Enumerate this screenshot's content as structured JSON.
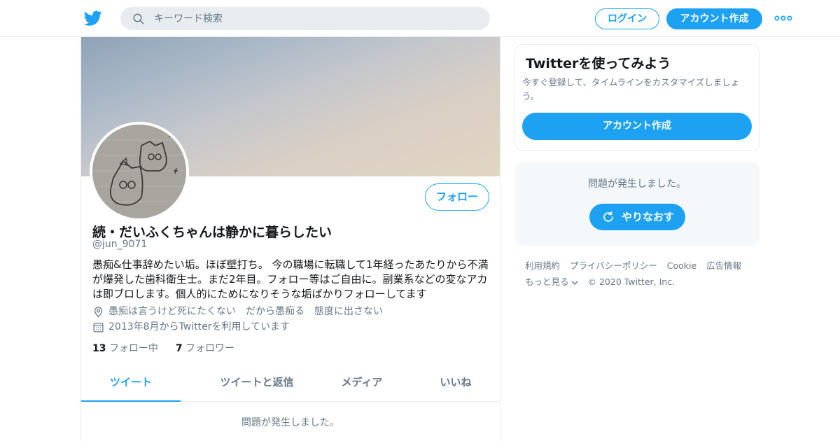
{
  "header": {
    "logo_icon": "twitter-bird-icon",
    "search_placeholder": "キーワード検索",
    "search_icon": "search-icon",
    "login_label": "ログイン",
    "signup_label": "アカウント作成",
    "more_icon": "more-dots-icon"
  },
  "profile": {
    "avatar_icon": "profile-avatar",
    "follow_label": "フォロー",
    "name": "続・だいふくちゃんは静かに暮らしたい",
    "handle": "@jun_9071",
    "bio": "愚痴&仕事辞めたい垢。ほぼ壁打ち。 今の職場に転職して1年経ったあたりから不満が爆発した歯科衛生士。まだ2年目。フォロー等はご自由に。副業系などの変なアカは即ブロします。個人的にためになりそうな垢ばかりフォローしてます",
    "location": "愚痴は言うけど死にたくない　だから愚痴る　態度に出さない",
    "location_icon": "location-pin-icon",
    "joined": "2013年8月からTwitterを利用しています",
    "joined_icon": "calendar-icon",
    "following_count": "13",
    "following_label": "フォロー中",
    "followers_count": "7",
    "followers_label": "フォロワー"
  },
  "tabs": [
    {
      "label": "ツイート",
      "active": true
    },
    {
      "label": "ツイートと返信",
      "active": false
    },
    {
      "label": "メディア",
      "active": false
    },
    {
      "label": "いいね",
      "active": false
    }
  ],
  "timeline": {
    "error_message": "問題が発生しました。"
  },
  "signup_card": {
    "title": "Twitterを使ってみよう",
    "description": "今すぐ登録して、タイムラインをカスタマイズしましょう。",
    "button_label": "アカウント作成"
  },
  "error_card": {
    "message": "問題が発生しました。",
    "retry_label": "やりなおす",
    "retry_icon": "refresh-icon"
  },
  "footer": {
    "links": [
      "利用規約",
      "プライバシーポリシー",
      "Cookie",
      "広告情報"
    ],
    "more_label": "もっと見る",
    "copyright": "© 2020 Twitter, Inc."
  },
  "colors": {
    "accent": "#1da1f2",
    "text_secondary": "#657786",
    "text_primary": "#14171a"
  }
}
